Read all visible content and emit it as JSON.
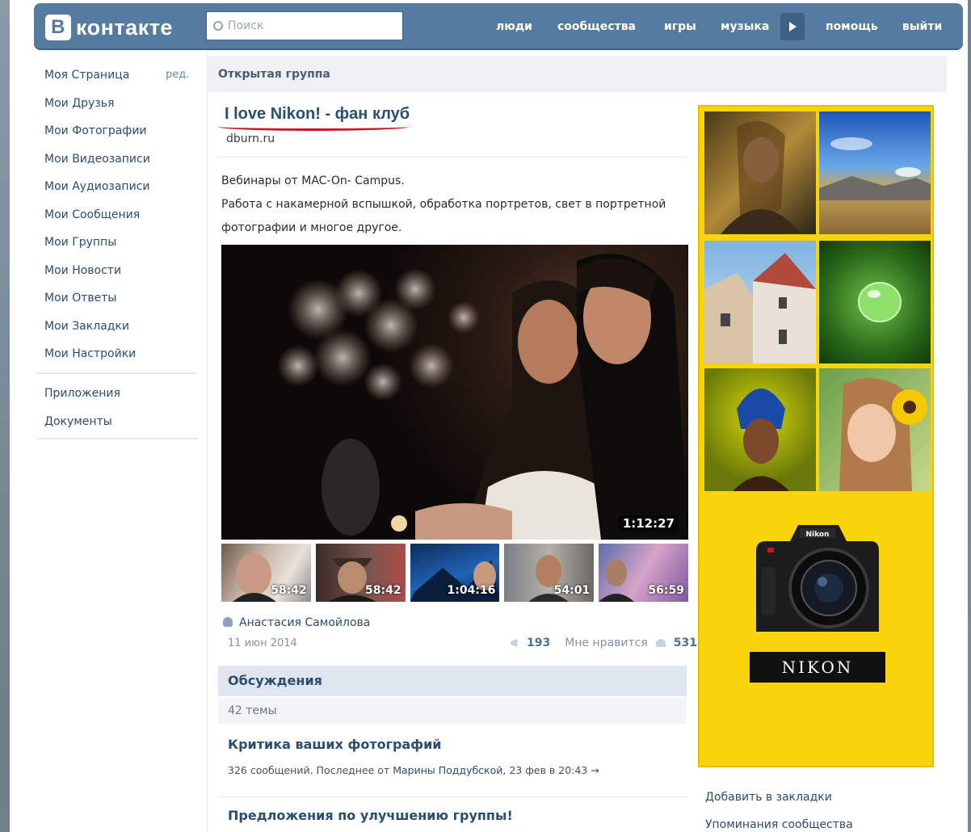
{
  "header": {
    "logo_b": "В",
    "logo_text": "контакте",
    "search_placeholder": "Поиск",
    "nav": [
      "люди",
      "сообщества",
      "игры",
      "музыка",
      "помощь",
      "выйти"
    ]
  },
  "sidebar": {
    "edit_label": "ред.",
    "items": [
      "Моя Страница",
      "Мои Друзья",
      "Мои Фотографии",
      "Мои Видеозаписи",
      "Мои Аудиозаписи",
      "Мои Сообщения",
      "Мои Группы",
      "Мои Новости",
      "Мои Ответы",
      "Мои Закладки",
      "Мои Настройки"
    ],
    "extra": [
      "Приложения",
      "Документы"
    ]
  },
  "group": {
    "type_label": "Открытая группа",
    "title": "I love Nikon! - фан клуб",
    "site": "dburn.ru",
    "description": [
      "Вебинары от MAC-On- Campus.",
      "Работа с накамерной вспышкой, обработка портретов, свет в портретной",
      "фотографии и многое другое."
    ]
  },
  "video": {
    "main_duration": "1:12:27",
    "thumbs": [
      "58:42",
      "58:42",
      "1:04:16",
      "54:01",
      "56:59"
    ]
  },
  "post": {
    "author": "Анастасия Самойлова",
    "date": "11 июн 2014",
    "shares": "193",
    "like_label": "Мне нравится",
    "likes": "531"
  },
  "discussions": {
    "title": "Обсуждения",
    "count": "42 темы",
    "topics": [
      {
        "title": "Критика ваших фотографий",
        "meta_prefix": "326 сообщений. Последнее от ",
        "meta_author": "Марины Поддубской",
        "meta_suffix": ", 23 фев в 20:43 →"
      },
      {
        "title": "Предложения по улучшению группы!"
      }
    ]
  },
  "ad": {
    "brand": "NIKON",
    "camera_brand": "Nikon"
  },
  "right_links": [
    "Добавить в закладки",
    "Упоминания сообщества"
  ]
}
